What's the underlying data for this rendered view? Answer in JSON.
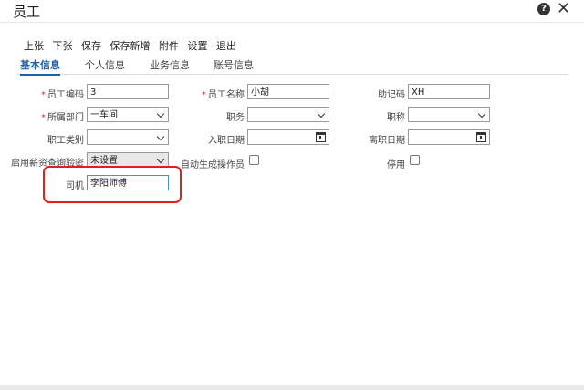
{
  "window": {
    "title": "员工"
  },
  "toolbar": {
    "items": [
      "上张",
      "下张",
      "保存",
      "保存新增",
      "附件",
      "设置",
      "退出"
    ]
  },
  "tabs": [
    "基本信息",
    "个人信息",
    "业务信息",
    "账号信息"
  ],
  "form": {
    "employee_code": {
      "label": "员工编码",
      "value": "3"
    },
    "employee_name": {
      "label": "员工名称",
      "value": "小胡"
    },
    "mnemonic": {
      "label": "助记码",
      "value": "XH"
    },
    "department": {
      "label": "所属部门",
      "value": "一车间"
    },
    "position": {
      "label": "职务",
      "value": ""
    },
    "title": {
      "label": "职称",
      "value": ""
    },
    "category": {
      "label": "职工类别",
      "value": ""
    },
    "hire_date": {
      "label": "入职日期",
      "value": ""
    },
    "leave_date": {
      "label": "离职日期",
      "value": ""
    },
    "salary_verify": {
      "label": "启用薪资查询验密",
      "value": "未设置"
    },
    "auto_operator": {
      "label": "自动生成操作员"
    },
    "disabled": {
      "label": "停用"
    },
    "driver": {
      "label": "司机",
      "value": "李阳师傅"
    }
  },
  "required_mark": "*",
  "colors": {
    "highlight": "#e0201c",
    "accent": "#1f5fa8"
  }
}
